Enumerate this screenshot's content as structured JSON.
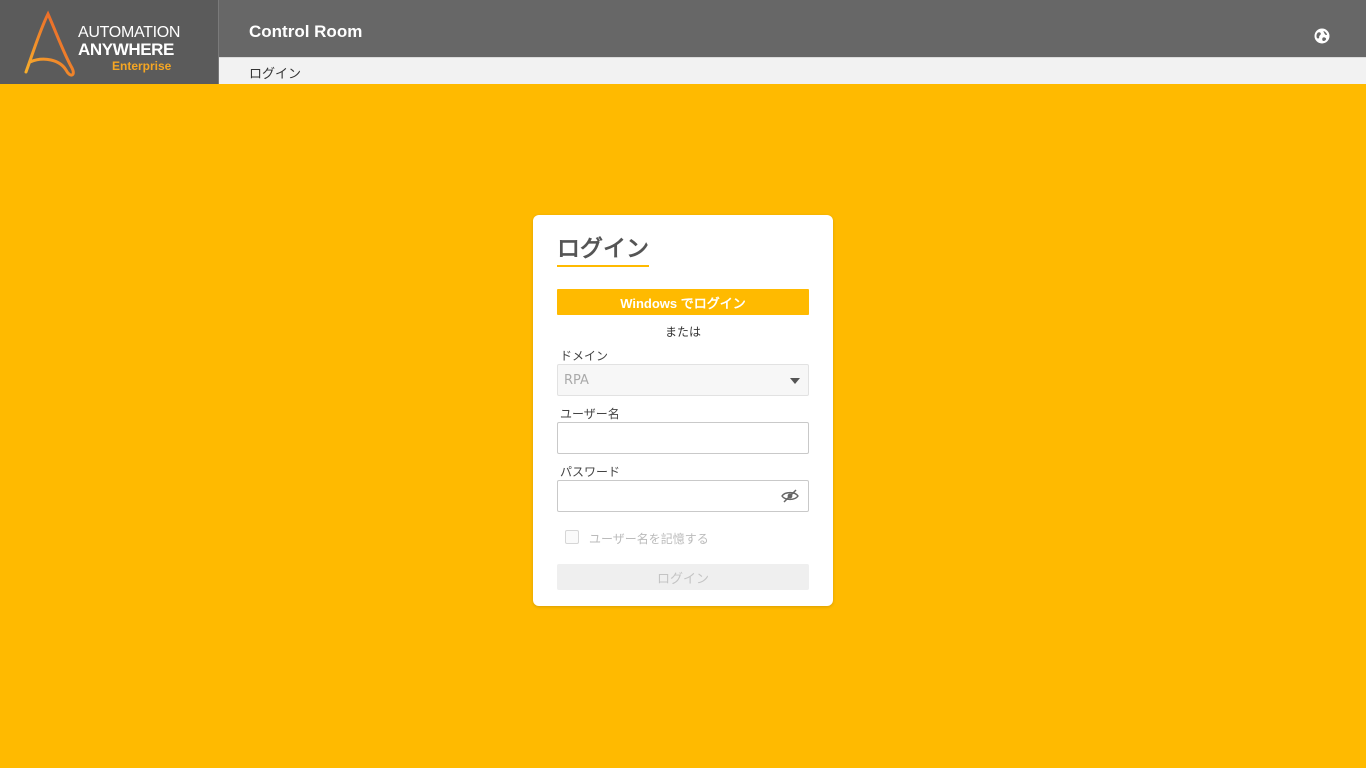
{
  "header": {
    "logo": {
      "line1": "AUTOMATION",
      "line2": "ANYWHERE",
      "line3": "Enterprise"
    },
    "title": "Control Room",
    "globe_icon": "globe-icon",
    "breadcrumb": "ログイン"
  },
  "login": {
    "title": "ログイン",
    "windows_button": "Windows でログイン",
    "or_text": "または",
    "domain": {
      "label": "ドメイン",
      "value": "RPA",
      "icon": "chevron-down-icon"
    },
    "username": {
      "label": "ユーザー名",
      "value": "",
      "placeholder": ""
    },
    "password": {
      "label": "パスワード",
      "value": "",
      "placeholder": "",
      "icon": "eye-off-icon"
    },
    "remember": {
      "label": "ユーザー名を記憶する",
      "checked": false
    },
    "submit_button": "ログイン"
  },
  "colors": {
    "accent": "#ffba00",
    "header": "#676767",
    "logo_bg": "#5b5b5b",
    "logo_orange": "#f5a623"
  }
}
